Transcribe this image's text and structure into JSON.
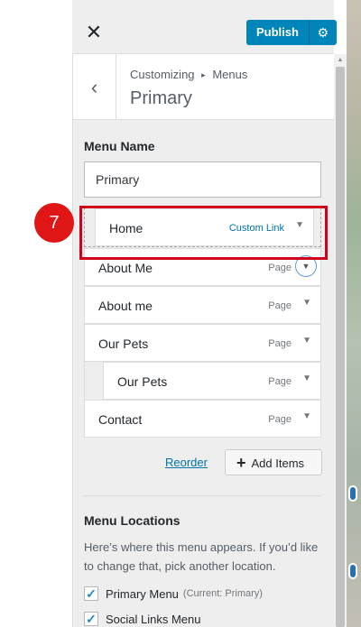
{
  "header": {
    "close_glyph": "✕",
    "publish_label": "Publish",
    "gear_icon": "gear-icon"
  },
  "panel": {
    "back_glyph": "‹",
    "breadcrumb_parent": "Customizing",
    "breadcrumb_separator": "▸",
    "breadcrumb_child": "Menus",
    "title": "Primary"
  },
  "menu_name": {
    "label": "Menu Name",
    "value": "Primary"
  },
  "annotation": {
    "step_number": "7",
    "highlight_color": "#d0021b"
  },
  "menu_items": [
    {
      "title": "Home",
      "type": "Custom Link"
    },
    {
      "title": "About Me",
      "type": "Page"
    },
    {
      "title": "About me",
      "type": "Page"
    },
    {
      "title": "Our Pets",
      "type": "Page"
    },
    {
      "title": "Our Pets",
      "type": "Page"
    },
    {
      "title": "Contact",
      "type": "Page"
    }
  ],
  "actions": {
    "reorder_label": "Reorder",
    "add_items_label": "Add Items"
  },
  "locations": {
    "heading": "Menu Locations",
    "description": "Here’s where this menu appears. If you’d like to change that, pick another location.",
    "items": [
      {
        "label": "Primary Menu",
        "current": "(Current: Primary)",
        "checked": true
      },
      {
        "label": "Social Links Menu",
        "current": "",
        "checked": true
      }
    ]
  },
  "colors": {
    "accent": "#0085ba",
    "link": "#0073aa"
  }
}
